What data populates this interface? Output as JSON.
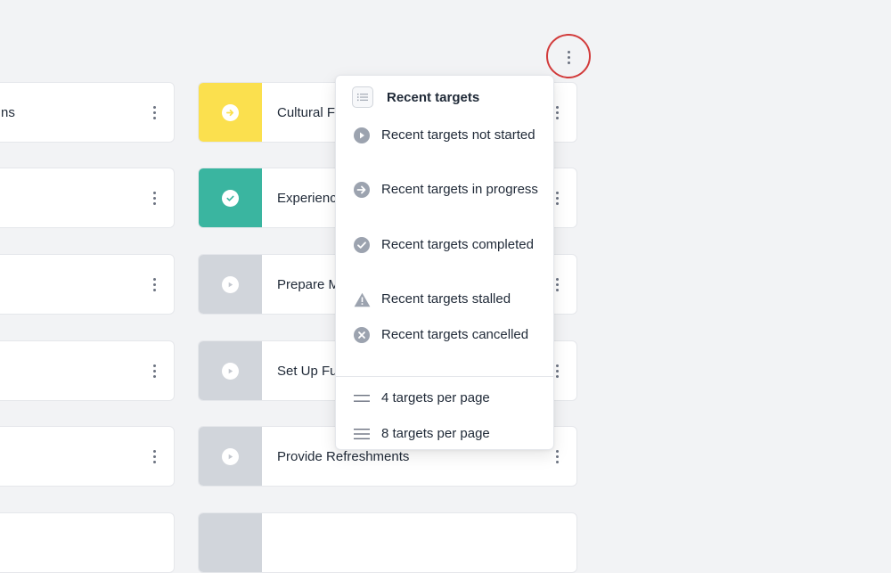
{
  "left_cards": [
    {
      "label": "ns"
    },
    {
      "label": ""
    },
    {
      "label": ""
    },
    {
      "label": ""
    },
    {
      "label": ""
    },
    {
      "label": ""
    }
  ],
  "right_cards": [
    {
      "label": "Cultural F",
      "status": "in-progress",
      "color": "#fbe04e"
    },
    {
      "label": "Experienc",
      "status": "completed",
      "color": "#3ab5a0"
    },
    {
      "label": "Prepare M",
      "status": "not-started",
      "color": "#d1d5db"
    },
    {
      "label": "Set Up Fu",
      "status": "not-started",
      "color": "#d1d5db"
    },
    {
      "label": "Provide Refreshments",
      "status": "not-started",
      "color": "#d1d5db"
    },
    {
      "label": "",
      "status": "not-started",
      "color": "#d1d5db"
    }
  ],
  "menu": {
    "title": "Recent targets",
    "header_icon": "list-icon",
    "items": [
      {
        "label": "Recent targets not started",
        "icon": "play-circle-icon"
      },
      {
        "label": "Recent targets in progress",
        "icon": "arrow-circle-icon"
      },
      {
        "label": "Recent targets completed",
        "icon": "check-circle-icon"
      },
      {
        "label": "Recent targets stalled",
        "icon": "warning-triangle-icon"
      },
      {
        "label": "Recent targets cancelled",
        "icon": "x-circle-icon"
      }
    ],
    "page_options": [
      {
        "label": "4 targets per page",
        "icon": "two-lines-icon"
      },
      {
        "label": "8 targets per page",
        "icon": "three-lines-icon"
      }
    ]
  },
  "colors": {
    "highlight_ring": "#d23b3b",
    "icon_gray": "#9ca3af"
  }
}
